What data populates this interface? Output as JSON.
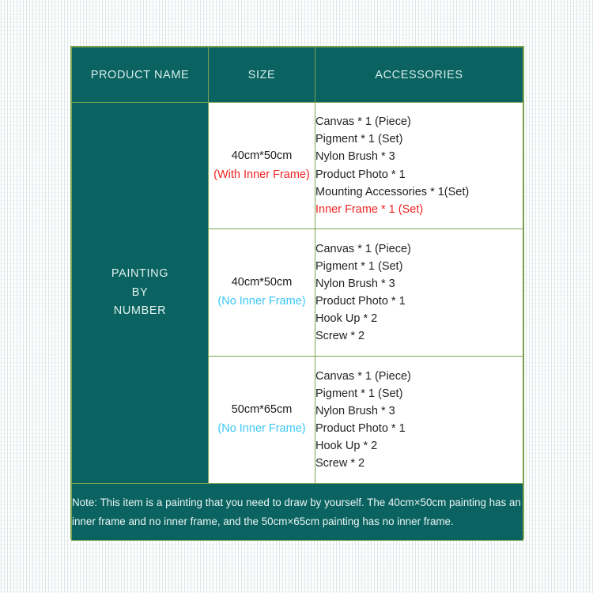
{
  "table": {
    "headers": {
      "product_name": "PRODUCT NAME",
      "size": "SIZE",
      "accessories": "ACCESSORIES"
    },
    "product_name": {
      "line1": "PAINTING",
      "line2": "BY",
      "line3": "NUMBER"
    },
    "rows": [
      {
        "size_dimension": "40cm*50cm",
        "size_note": "(With Inner Frame)",
        "size_note_type": "with-frame",
        "accessories": [
          {
            "text": "Canvas * 1 (Piece)",
            "highlight": false
          },
          {
            "text": "Pigment * 1 (Set)",
            "highlight": false
          },
          {
            "text": "Nylon Brush * 3",
            "highlight": false
          },
          {
            "text": "Product Photo * 1",
            "highlight": false
          },
          {
            "text": "Mounting Accessories * 1(Set)",
            "highlight": false
          },
          {
            "text": "Inner Frame * 1 (Set)",
            "highlight": true
          }
        ]
      },
      {
        "size_dimension": "40cm*50cm",
        "size_note": "(No Inner Frame)",
        "size_note_type": "no-frame",
        "accessories": [
          {
            "text": "Canvas * 1 (Piece)",
            "highlight": false
          },
          {
            "text": "Pigment * 1 (Set)",
            "highlight": false
          },
          {
            "text": "Nylon Brush * 3",
            "highlight": false
          },
          {
            "text": "Product Photo * 1",
            "highlight": false
          },
          {
            "text": "Hook Up * 2",
            "highlight": false
          },
          {
            "text": "Screw * 2",
            "highlight": false
          }
        ]
      },
      {
        "size_dimension": "50cm*65cm",
        "size_note": "(No Inner Frame)",
        "size_note_type": "no-frame",
        "accessories": [
          {
            "text": "Canvas * 1 (Piece)",
            "highlight": false
          },
          {
            "text": "Pigment * 1 (Set)",
            "highlight": false
          },
          {
            "text": "Nylon Brush * 3",
            "highlight": false
          },
          {
            "text": "Product Photo * 1",
            "highlight": false
          },
          {
            "text": "Hook Up * 2",
            "highlight": false
          },
          {
            "text": "Screw * 2",
            "highlight": false
          }
        ]
      }
    ],
    "note": "Note: This item is a painting that you need to draw by yourself. The 40cm×50cm painting has an inner frame and no inner frame, and the 50cm×65cm painting has no inner frame."
  },
  "colors": {
    "teal": "#0a6360",
    "border_green": "#7ba352",
    "highlight_red": "#f12222",
    "highlight_cyan": "#3bc8f5",
    "header_text": "#d6eceb"
  }
}
